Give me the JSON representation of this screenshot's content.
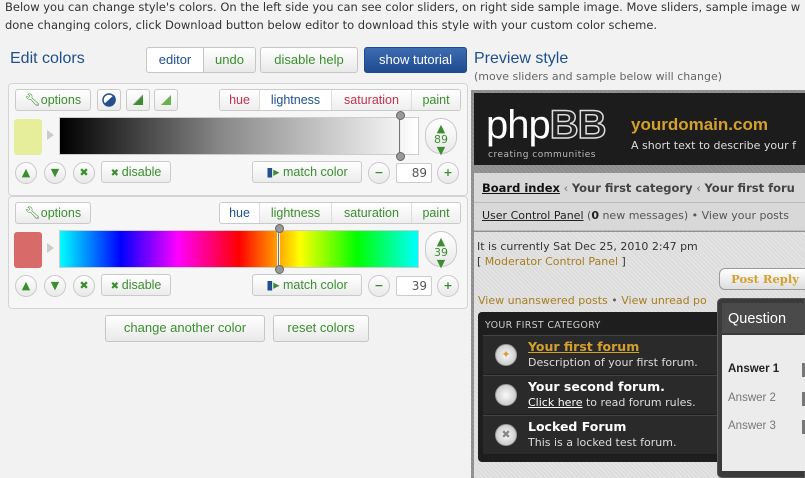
{
  "intro": {
    "line1": "Below you can change style's colors. On the left side you can see color sliders, on right side sample image. Move sliders, sample image w",
    "line2": "done changing colors, click Download button below editor to download this style with your custom color scheme."
  },
  "editor": {
    "title": "Edit colors",
    "toolbar": {
      "editor": "editor",
      "undo": "undo",
      "disable_help": "disable help",
      "show_tutorial": "show tutorial"
    },
    "panel1": {
      "options": "options",
      "tabs": [
        "hue",
        "lightness",
        "saturation",
        "paint"
      ],
      "active_tab": "lightness",
      "value": "89",
      "badge_value": "89",
      "disable": "disable",
      "match_color": "match color",
      "swatch_color": "#e6ee9c"
    },
    "panel2": {
      "options": "options",
      "tabs": [
        "hue",
        "lightness",
        "saturation",
        "paint"
      ],
      "active_tab": "hue",
      "value": "39",
      "badge_value": "39",
      "disable": "disable",
      "match_color": "match color",
      "swatch_color": "#d96a6a"
    },
    "change_another_color": "change another color",
    "reset_colors": "reset colors"
  },
  "preview": {
    "title": "Preview style",
    "subtitle": "(move sliders and sample below will change)",
    "logo_text": "php",
    "logo_bb": "BB",
    "logo_sub": "creating communities",
    "domain": "yourdomain.com",
    "description": "A short text to describe your f",
    "breadcrumb": {
      "board_index": "Board index",
      "cat1": "Your first category",
      "cat2": "Your first foru"
    },
    "ucp_link": "User Control Panel",
    "ucp_count": "0",
    "ucp_rest": " new messages) • View your posts",
    "time_info": "It is currently Sat Dec 25, 2010 2:47 pm",
    "mcp_link": "Moderator Control Panel",
    "post_reply": "Post Reply",
    "unanswered": "View unanswered posts",
    "unread": "View unread po",
    "category": "YOUR FIRST CATEGORY",
    "forums": [
      {
        "title": "Your first forum",
        "desc": "Description of your first forum."
      },
      {
        "title": "Your second forum.",
        "desc_link": "Click here",
        "desc_rest": " to read forum rules."
      },
      {
        "title": "Locked Forum",
        "desc": "This is a locked test forum."
      }
    ],
    "question_title": "Question",
    "answers": [
      "Answer 1",
      "Answer 2",
      "Answer 3"
    ]
  }
}
